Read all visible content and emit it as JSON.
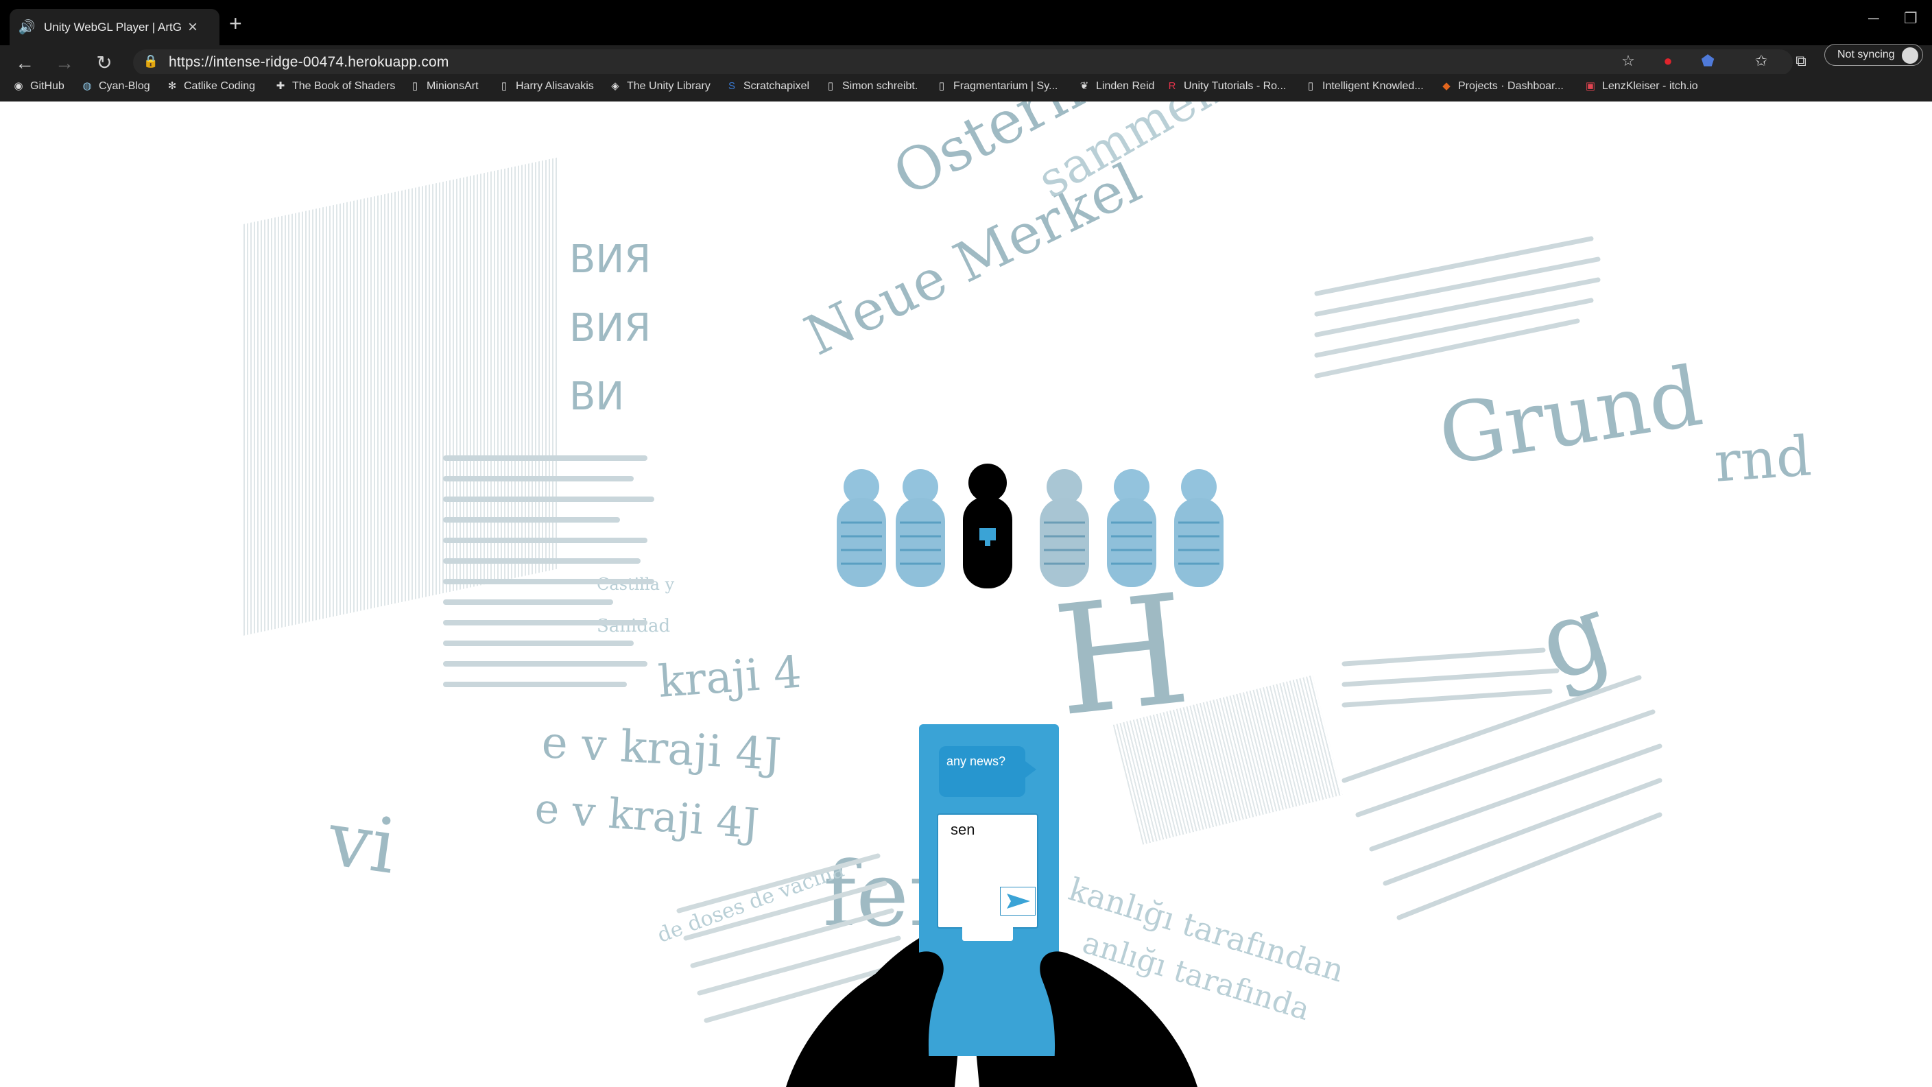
{
  "browser": {
    "tab_title": "Unity WebGL Player | ArtG...",
    "url": "https://intense-ridge-00474.herokuapp.com",
    "sync_label": "Not syncing",
    "bookmarks": [
      {
        "label": "GitHub",
        "icon": "github-icon"
      },
      {
        "label": "Cyan-Blog",
        "icon": "globe-icon"
      },
      {
        "label": "Catlike Coding",
        "icon": "cat-icon"
      },
      {
        "label": "The Book of Shaders",
        "icon": "plus-icon"
      },
      {
        "label": "MinionsArt",
        "icon": "page-icon"
      },
      {
        "label": "Harry Alisavakis",
        "icon": "page-icon"
      },
      {
        "label": "The Unity Library",
        "icon": "unity-icon"
      },
      {
        "label": "Scratchapixel",
        "icon": "s-logo-icon"
      },
      {
        "label": "Simon schreibt.",
        "icon": "page-icon"
      },
      {
        "label": "Fragmentarium | Sy...",
        "icon": "page-icon"
      },
      {
        "label": "Linden Reid",
        "icon": "leaf-icon"
      },
      {
        "label": "Unity Tutorials - Ro...",
        "icon": "r-logo-icon"
      },
      {
        "label": "Intelligent Knowled...",
        "icon": "page-icon"
      },
      {
        "label": "Projects · Dashboar...",
        "icon": "gitlab-icon"
      },
      {
        "label": "LenzKleiser - itch.io",
        "icon": "itch-icon"
      }
    ]
  },
  "game": {
    "chat_message": "any news?",
    "input_text": "sen",
    "accent_color": "#3aa3d6",
    "newspaper_fragments": [
      "Ostern",
      "Neue Merkel",
      "sammeno",
      "Grund",
      "kraji 4",
      "e v kraji 4J",
      "e v kraji 4J",
      "fer",
      "kanlığı tarafından",
      "anlığı tarafında",
      "H",
      "g",
      "rnd",
      "BИЯ",
      "BИЯ",
      "BИ",
      "vi",
      "Sanidad",
      "Castilla y",
      "de doses de vacina"
    ]
  }
}
